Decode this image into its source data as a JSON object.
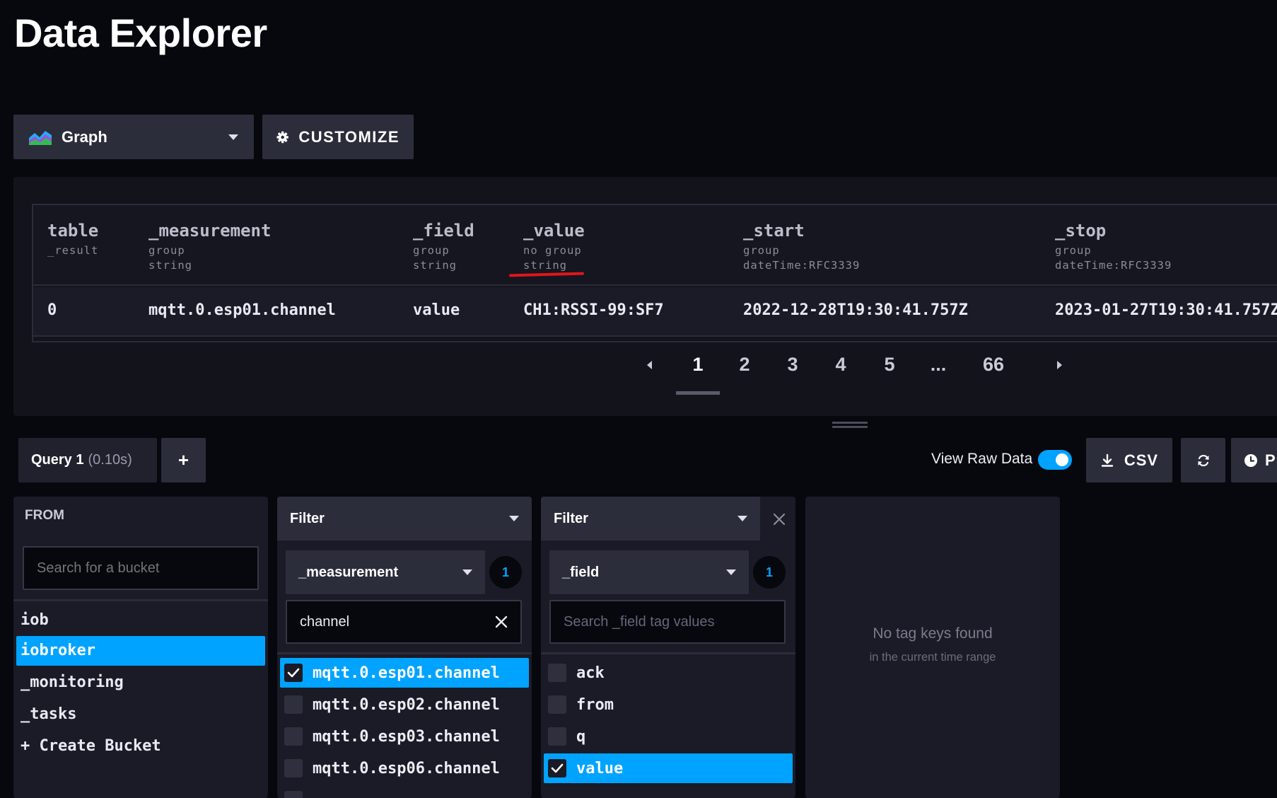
{
  "page": {
    "title": "Data Explorer"
  },
  "toolbar": {
    "vis_type": "Graph",
    "vis_icon": "graph-icon",
    "customize_label": "CUSTOMIZE",
    "customize_icon": "gear-icon"
  },
  "results": {
    "columns": [
      {
        "name": "table",
        "meta": [
          "_result"
        ]
      },
      {
        "name": "_measurement",
        "meta": [
          "group",
          "string"
        ]
      },
      {
        "name": "_field",
        "meta": [
          "group",
          "string"
        ]
      },
      {
        "name": "_value",
        "meta": [
          "no group",
          "string"
        ]
      },
      {
        "name": "_start",
        "meta": [
          "group",
          "dateTime:RFC3339"
        ]
      },
      {
        "name": "_stop",
        "meta": [
          "group",
          "dateTime:RFC3339"
        ]
      }
    ],
    "row": [
      "0",
      "mqtt.0.esp01.channel",
      "value",
      "CH1:RSSI-99:SF7",
      "2022-12-28T19:30:41.757Z",
      "2023-01-27T19:30:41.757Z"
    ],
    "annotation_color": "#e0161b"
  },
  "pagination": {
    "pages": [
      "1",
      "2",
      "3",
      "4",
      "5",
      "...",
      "66"
    ],
    "active": "1"
  },
  "query_bar": {
    "query_name": "Query 1",
    "query_time": "(0.10s)",
    "add_label": "+",
    "raw_data_label": "View Raw Data",
    "raw_data_on": true,
    "csv_label": "CSV",
    "time_label": "P"
  },
  "from": {
    "title": "FROM",
    "search_placeholder": "Search for a bucket",
    "buckets": [
      "iob",
      "iobroker",
      "_monitoring",
      "_tasks",
      "+ Create Bucket"
    ],
    "selected": "iobroker"
  },
  "filter1": {
    "header": "Filter",
    "key": "_measurement",
    "count": "1",
    "search_value": "channel",
    "values": [
      "mqtt.0.esp01.channel",
      "mqtt.0.esp02.channel",
      "mqtt.0.esp03.channel",
      "mqtt.0.esp06.channel"
    ],
    "selected": "mqtt.0.esp01.channel"
  },
  "filter2": {
    "header": "Filter",
    "key": "_field",
    "count": "1",
    "search_placeholder": "Search _field tag values",
    "values": [
      "ack",
      "from",
      "q",
      "value"
    ],
    "selected": "value"
  },
  "empty_state": {
    "title": "No tag keys found",
    "subtitle": "in the current time range"
  },
  "colors": {
    "accent": "#00a3ff",
    "panel": "#1a1b26",
    "button": "#2c2d3b",
    "background": "#07070e"
  }
}
